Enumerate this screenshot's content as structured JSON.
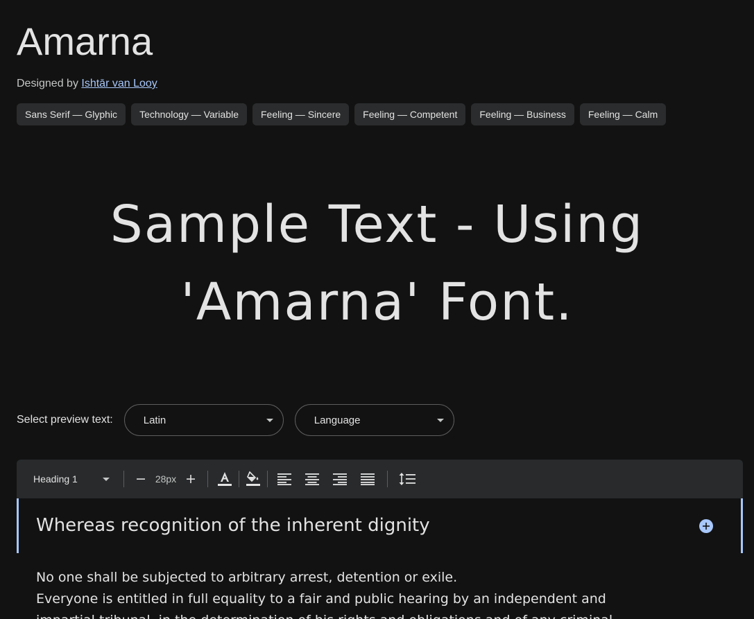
{
  "font": {
    "name": "Amarna",
    "designed_by_prefix": "Designed by ",
    "designer": "Ishtār van Looy"
  },
  "tags": [
    "Sans Serif — Glyphic",
    "Technology — Variable",
    "Feeling — Sincere",
    "Feeling — Competent",
    "Feeling — Business",
    "Feeling — Calm"
  ],
  "sample_text": {
    "line1": "Sample Text - Using",
    "line2": "'Amarna' Font."
  },
  "preview": {
    "label": "Select preview text:",
    "script_select": "Latin",
    "language_select": "Language"
  },
  "toolbar": {
    "style": "Heading 1",
    "font_size": "28px",
    "icons": [
      "minus-icon",
      "plus-icon",
      "text-color-icon",
      "fill-color-icon",
      "align-left-icon",
      "align-center-icon",
      "align-right-icon",
      "align-justify-icon",
      "line-height-icon"
    ]
  },
  "editor": {
    "heading": "Whereas recognition of the inherent dignity",
    "paragraph_lines": [
      "No one shall be subjected to arbitrary arrest, detention or exile.",
      "Everyone is entitled in full equality to a fair and public hearing by an independent and",
      "impartial tribunal, in the determination of his rights and obligations and of any criminal"
    ]
  },
  "colors": {
    "background": "#121212",
    "accent": "#a8c7fa",
    "chip": "#2b2c2d",
    "toolbar": "#282a2c"
  }
}
